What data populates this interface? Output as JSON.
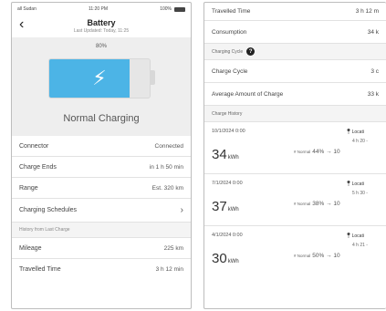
{
  "left": {
    "status": {
      "carrier": "all Sudan",
      "time": "11:20 PM",
      "battery": "100%"
    },
    "header": {
      "title": "Battery",
      "subtitle": "Last Updated: Today, 11:25"
    },
    "battery": {
      "percent_label": "80%",
      "percent": 80,
      "status": "Normal Charging",
      "color": "#4cb4e6",
      "icon": "bolt-icon"
    },
    "rows": [
      {
        "label": "Connector",
        "value": "Connected"
      },
      {
        "label": "Charge Ends",
        "value": "in 1 h 50 min"
      },
      {
        "label": "Range",
        "value": "Est. 320 km"
      }
    ],
    "schedules_label": "Charging Schedules",
    "history_section": "History from Last Charge",
    "history_rows": [
      {
        "label": "Mileage",
        "value": "225 km"
      },
      {
        "label": "Travelled Time",
        "value": "3 h 12 min"
      }
    ]
  },
  "right": {
    "top_rows": [
      {
        "label": "Travelled Time",
        "value": "3 h 12 m"
      },
      {
        "label": "Consumption",
        "value": "34 k"
      }
    ],
    "cycle_section": "Charging Cycle",
    "cycle_rows": [
      {
        "label": "Charge Cycle",
        "value": "3 c"
      },
      {
        "label": "Average Amount of Charge",
        "value": "33 k"
      }
    ],
    "history_section": "Charge History",
    "history": [
      {
        "date": "10/1/2024 0:00",
        "energy": "34",
        "unit": "kWh",
        "location": "Locati",
        "duration": "4 h 20 -",
        "mode": "# Normal",
        "range": "44% → 10"
      },
      {
        "date": "7/1/2024 0:00",
        "energy": "37",
        "unit": "kWh",
        "location": "Locati",
        "duration": "5 h 30 -",
        "mode": "# Normal",
        "range": "38% → 10"
      },
      {
        "date": "4/1/2024 0:00",
        "energy": "30",
        "unit": "kWh",
        "location": "Locati",
        "duration": "4 h 21 -",
        "mode": "# Normal",
        "range": "50% → 10"
      }
    ]
  }
}
